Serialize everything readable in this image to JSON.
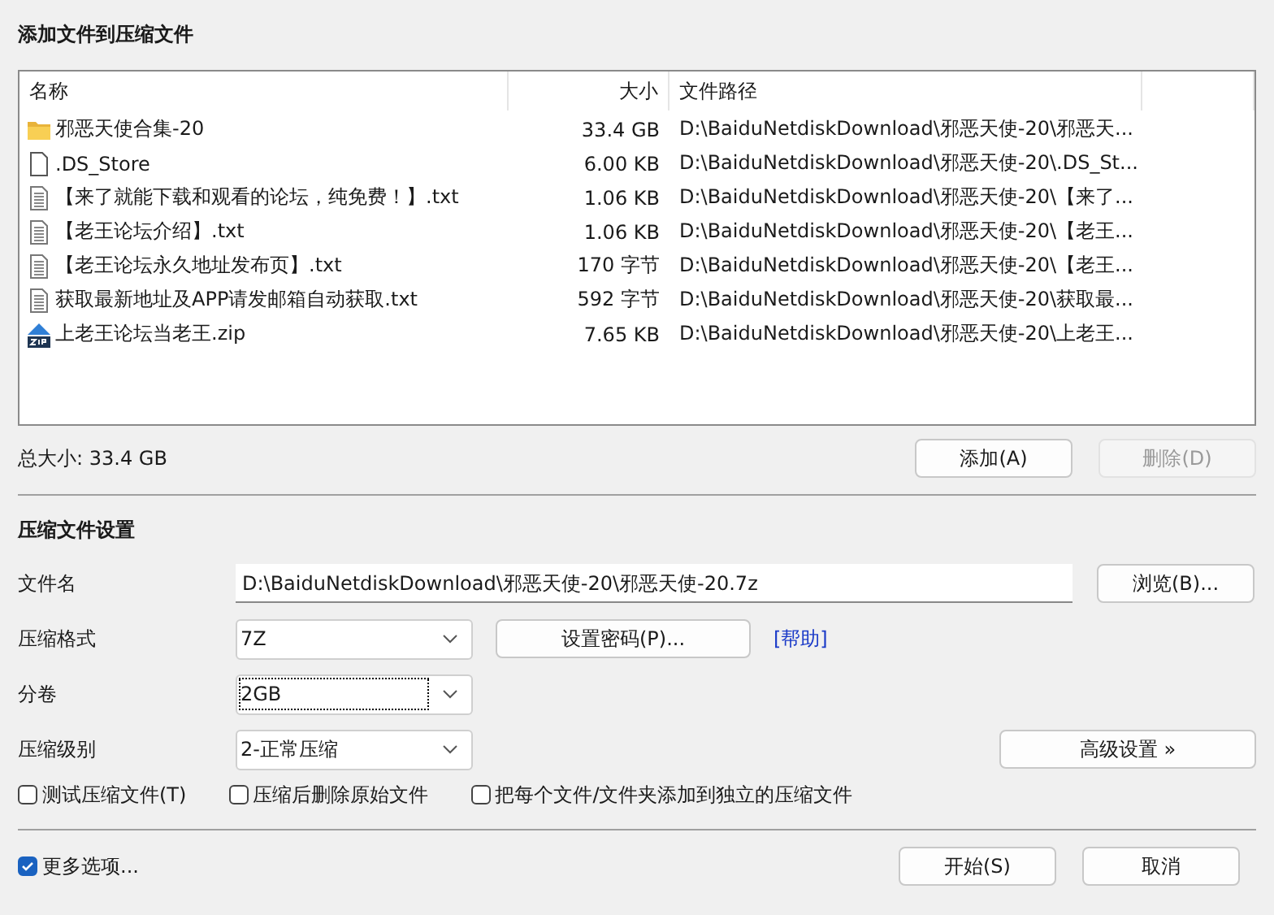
{
  "title": "添加文件到压缩文件",
  "file_list": {
    "columns": [
      "名称",
      "大小",
      "文件路径"
    ],
    "rows": [
      {
        "kind": "folder",
        "name": "邪恶天使合集-20",
        "size": "33.4 GB",
        "path": "D:\\BaiduNetdiskDownload\\邪恶天使-20\\邪恶天..."
      },
      {
        "kind": "blank",
        "name": ".DS_Store",
        "size": "6.00 KB",
        "path": "D:\\BaiduNetdiskDownload\\邪恶天使-20\\.DS_St..."
      },
      {
        "kind": "text",
        "name": "【来了就能下载和观看的论坛，纯免费！】.txt",
        "size": "1.06 KB",
        "path": "D:\\BaiduNetdiskDownload\\邪恶天使-20\\【来了..."
      },
      {
        "kind": "text",
        "name": "【老王论坛介绍】.txt",
        "size": "1.06 KB",
        "path": "D:\\BaiduNetdiskDownload\\邪恶天使-20\\【老王..."
      },
      {
        "kind": "text",
        "name": "【老王论坛永久地址发布页】.txt",
        "size": "170 字节",
        "path": "D:\\BaiduNetdiskDownload\\邪恶天使-20\\【老王..."
      },
      {
        "kind": "text",
        "name": "获取最新地址及APP请发邮箱自动获取.txt",
        "size": "592 字节",
        "path": "D:\\BaiduNetdiskDownload\\邪恶天使-20\\获取最..."
      },
      {
        "kind": "zip",
        "name": "上老王论坛当老王.zip",
        "size": "7.65 KB",
        "path": "D:\\BaiduNetdiskDownload\\邪恶天使-20\\上老王..."
      }
    ]
  },
  "total_size": "总大小: 33.4 GB",
  "list_buttons": [
    {
      "label": "添加(A)",
      "disabled": false
    },
    {
      "label": "删除(D)",
      "disabled": true
    }
  ],
  "settings": {
    "heading": "压缩文件设置",
    "filename": {
      "label": "文件名",
      "value": "D:\\BaiduNetdiskDownload\\邪恶天使-20\\邪恶天使-20.7z",
      "button": "浏览(B)..."
    },
    "format": {
      "label": "压缩格式",
      "value": "7Z",
      "button": "设置密码(P)...",
      "link": "[帮助]"
    },
    "volume": {
      "label": "分卷",
      "value": "2GB",
      "focused": true
    },
    "level": {
      "label": "压缩级别",
      "value": "2-正常压缩",
      "button": "高级设置 »"
    },
    "checkboxes": [
      {
        "label": "测试压缩文件(T)",
        "checked": false
      },
      {
        "label": "压缩后删除原始文件",
        "checked": false
      },
      {
        "label": "把每个文件/文件夹添加到独立的压缩文件",
        "checked": false
      }
    ]
  },
  "more_options": {
    "label": "更多选项...",
    "checked": true
  },
  "buttons": [
    "开始(S)",
    "取消"
  ]
}
